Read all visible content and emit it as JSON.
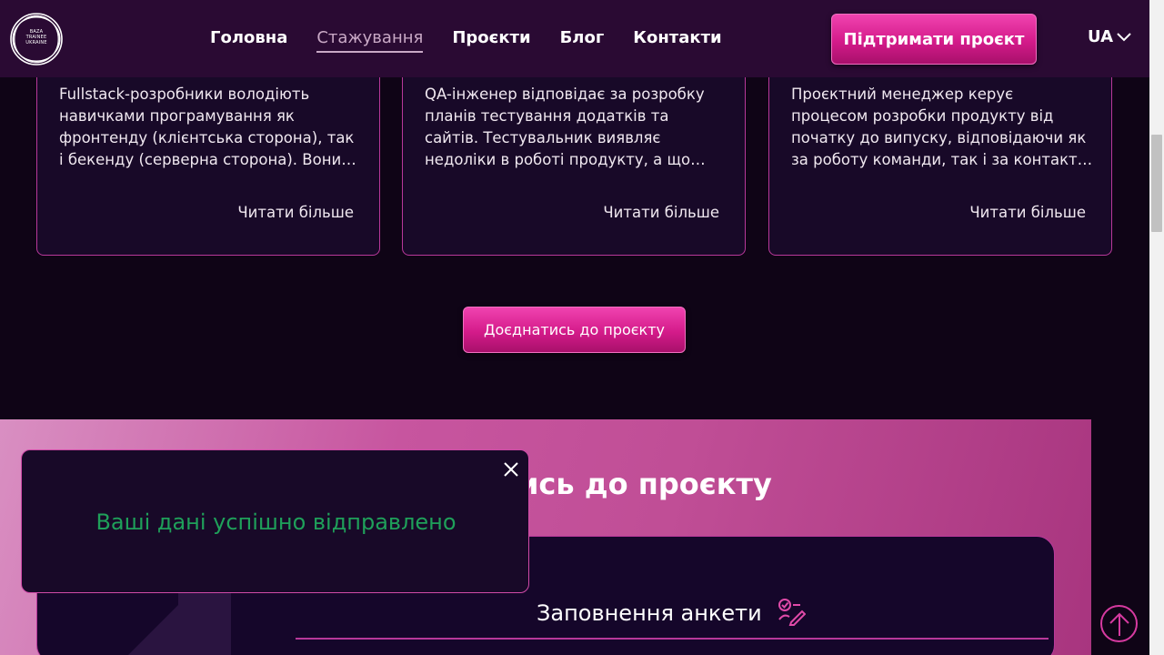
{
  "header": {
    "logo_text": [
      "BAZA",
      "TRAINEE",
      "UKRAINE"
    ],
    "nav": [
      {
        "label": "Головна",
        "active": false
      },
      {
        "label": "Стажування",
        "active": true
      },
      {
        "label": "Проєкти",
        "active": false
      },
      {
        "label": "Блог",
        "active": false
      },
      {
        "label": "Контакти",
        "active": false
      }
    ],
    "support_label": "Підтримати проєкт",
    "language": "UA"
  },
  "cards": [
    {
      "description": "Fullstack-розробники володіють навичками програмування як фронтенду (клієнтська сторона), так і бекенду (серверна сторона). Вони…",
      "more": "Читати більше"
    },
    {
      "description": "QA-інженер відповідає за розробку планів тестування додатків та сайтів. Тестувальник виявляє недоліки в роботі продукту, а що найважливіше…",
      "more": "Читати більше"
    },
    {
      "description": "Проєктний менеджер керує процесом розробки продукту від початку до випуску, відповідаючи як за роботу команди, так і за контакти …",
      "more": "Читати більше"
    }
  ],
  "join_button": "Доєднатись до проєкту",
  "join_section": {
    "title": "ись до проєкту",
    "form_heading": "Заповнення анкети"
  },
  "toast": {
    "message": "Ваші дані успішно відправлено"
  },
  "colors": {
    "accent": "#d41b8a",
    "header_bg": "#2a0a33",
    "page_bg": "#0f0416",
    "success": "#1fa05a"
  },
  "icons": [
    "close-icon",
    "chevron-down-icon",
    "checklist-edit-icon",
    "arrow-up-icon"
  ]
}
